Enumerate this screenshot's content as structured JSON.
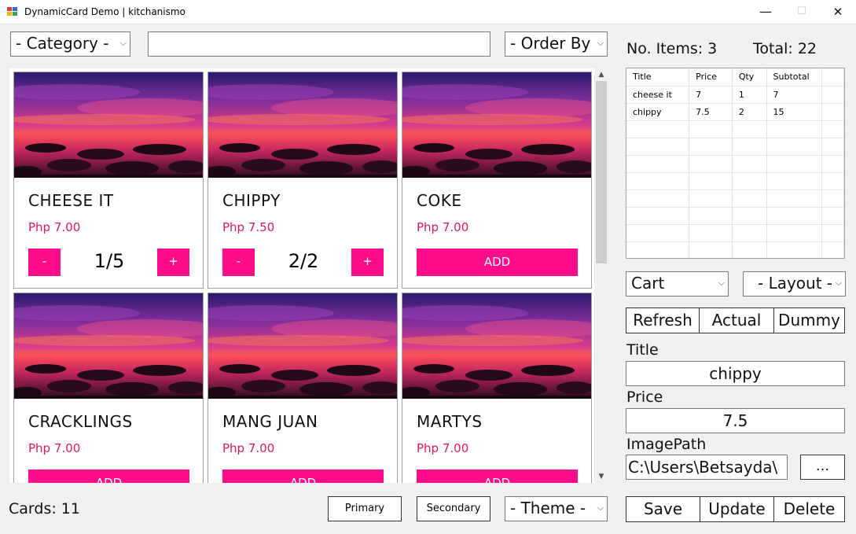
{
  "window": {
    "title": "DynamicCard Demo | kitchanismo",
    "minimize": "—",
    "maximize": "☐",
    "close": "✕"
  },
  "toolbar": {
    "category": "- Category -",
    "search_value": "",
    "order_by": "- Order By"
  },
  "cards": [
    {
      "title": "CHEESE IT",
      "price": "Php 7.00",
      "qty": "1/5",
      "minus": "-",
      "plus": "+"
    },
    {
      "title": "CHIPPY",
      "price": "Php 7.50",
      "qty": "2/2",
      "minus": "-",
      "plus": "+"
    },
    {
      "title": "COKE",
      "price": "Php 7.00",
      "add": "ADD"
    },
    {
      "title": "CRACKLINGS",
      "price": "Php 7.00",
      "add": "ADD"
    },
    {
      "title": "MANG JUAN",
      "price": "Php 7.00",
      "add": "ADD"
    },
    {
      "title": "MARTYS",
      "price": "Php 7.00",
      "add": "ADD"
    }
  ],
  "footer": {
    "cards_count": "Cards: 11",
    "primary": "Primary",
    "secondary": "Secondary",
    "theme": "- Theme -"
  },
  "summary": {
    "items": "No. Items: 3",
    "total": "Total: 22"
  },
  "cart_table": {
    "columns": [
      "Title",
      "Price",
      "Qty",
      "Subtotal"
    ],
    "rows": [
      [
        "cheese it",
        "7",
        "1",
        "7"
      ],
      [
        "chippy",
        "7.5",
        "2",
        "15"
      ]
    ]
  },
  "controls": {
    "cart_select": "Cart",
    "layout_select": "- Layout -",
    "refresh": "Refresh",
    "actual": "Actual",
    "dummy": "Dummy"
  },
  "form": {
    "title_label": "Title",
    "title_value": "chippy",
    "price_label": "Price",
    "price_value": "7.5",
    "image_label": "ImagePath",
    "image_value": "C:\\Users\\Betsayda\\",
    "browse": "...",
    "save": "Save",
    "update": "Update",
    "delete": "Delete"
  },
  "colors": {
    "accent": "#ff0c8a",
    "price": "#e4165b"
  }
}
